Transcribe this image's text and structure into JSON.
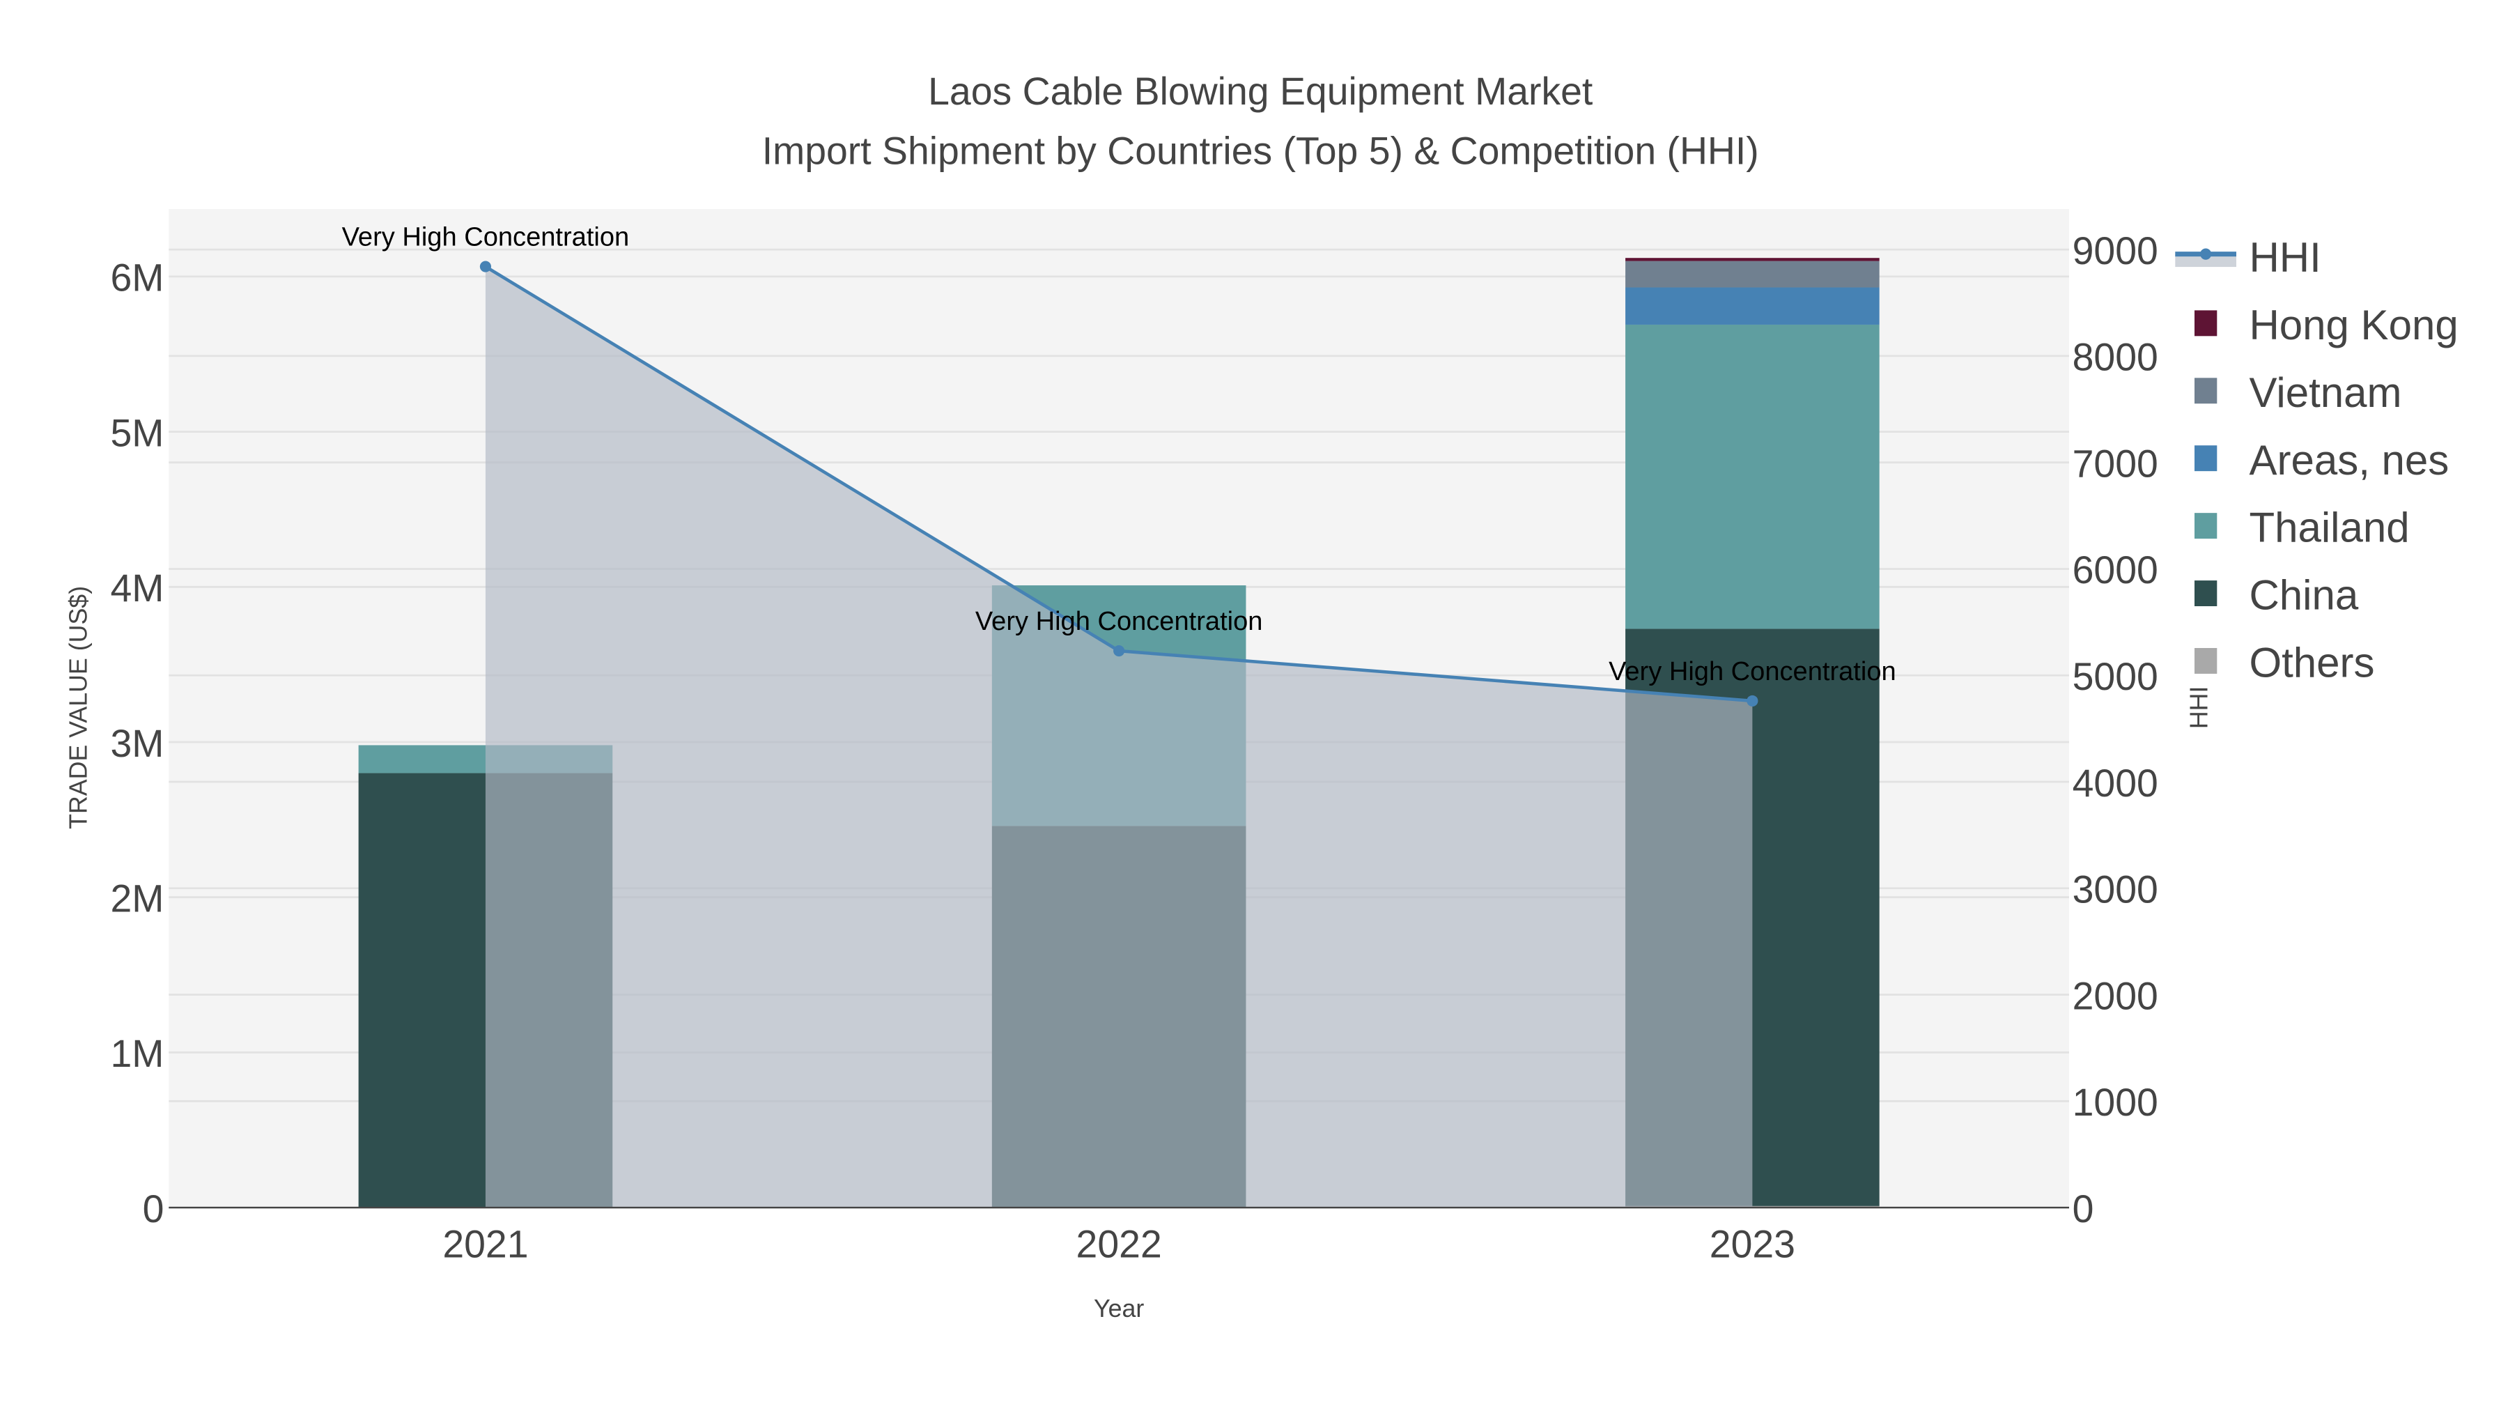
{
  "chart_data": {
    "type": "bar",
    "title": "Laos Cable Blowing Equipment Market",
    "subtitle": "Import Shipment by Countries (Top 5) & Competition (HHI)",
    "xlabel": "Year",
    "ylabel": "TRADE VALUE (US$)",
    "y2label": "HHI",
    "categories": [
      "2021",
      "2022",
      "2023"
    ],
    "stacked": true,
    "ylim": [
      0,
      6400000
    ],
    "y2lim": [
      0,
      9350
    ],
    "yticks": [
      {
        "v": 0,
        "label": "0"
      },
      {
        "v": 1000000,
        "label": "1M"
      },
      {
        "v": 2000000,
        "label": "2M"
      },
      {
        "v": 3000000,
        "label": "3M"
      },
      {
        "v": 4000000,
        "label": "4M"
      },
      {
        "v": 5000000,
        "label": "5M"
      },
      {
        "v": 6000000,
        "label": "6M"
      }
    ],
    "y2ticks": [
      {
        "v": 0,
        "label": "0"
      },
      {
        "v": 1000,
        "label": "1000"
      },
      {
        "v": 2000,
        "label": "2000"
      },
      {
        "v": 3000,
        "label": "3000"
      },
      {
        "v": 4000,
        "label": "4000"
      },
      {
        "v": 5000,
        "label": "5000"
      },
      {
        "v": 6000,
        "label": "6000"
      },
      {
        "v": 7000,
        "label": "7000"
      },
      {
        "v": 8000,
        "label": "8000"
      },
      {
        "v": 9000,
        "label": "9000"
      }
    ],
    "series": [
      {
        "name": "Others",
        "color": "#A9A9A9",
        "values": [
          0,
          0,
          10000
        ]
      },
      {
        "name": "China",
        "color": "#2F4F4F",
        "values": [
          2800000,
          2460000,
          3720000
        ]
      },
      {
        "name": "Thailand",
        "color": "#5F9EA0",
        "values": [
          180000,
          1550000,
          1960000
        ]
      },
      {
        "name": "Areas, nes",
        "color": "#4682B4",
        "values": [
          0,
          0,
          240000
        ]
      },
      {
        "name": "Vietnam",
        "color": "#708090",
        "values": [
          0,
          0,
          170000
        ]
      },
      {
        "name": "Hong Kong",
        "color": "#5E1434",
        "values": [
          0,
          0,
          20000
        ]
      }
    ],
    "hhi": {
      "name": "HHI",
      "color": "#4682B4",
      "fill": "rgba(176,184,196,0.65)",
      "values": [
        8840,
        5230,
        4760
      ],
      "annotations": [
        "Very High Concentration",
        "Very High Concentration",
        "Very High Concentration"
      ]
    },
    "legend_order": [
      "HHI",
      "Hong Kong",
      "Vietnam",
      "Areas, nes",
      "Thailand",
      "China",
      "Others"
    ],
    "legend_position": "right",
    "grid": true
  }
}
